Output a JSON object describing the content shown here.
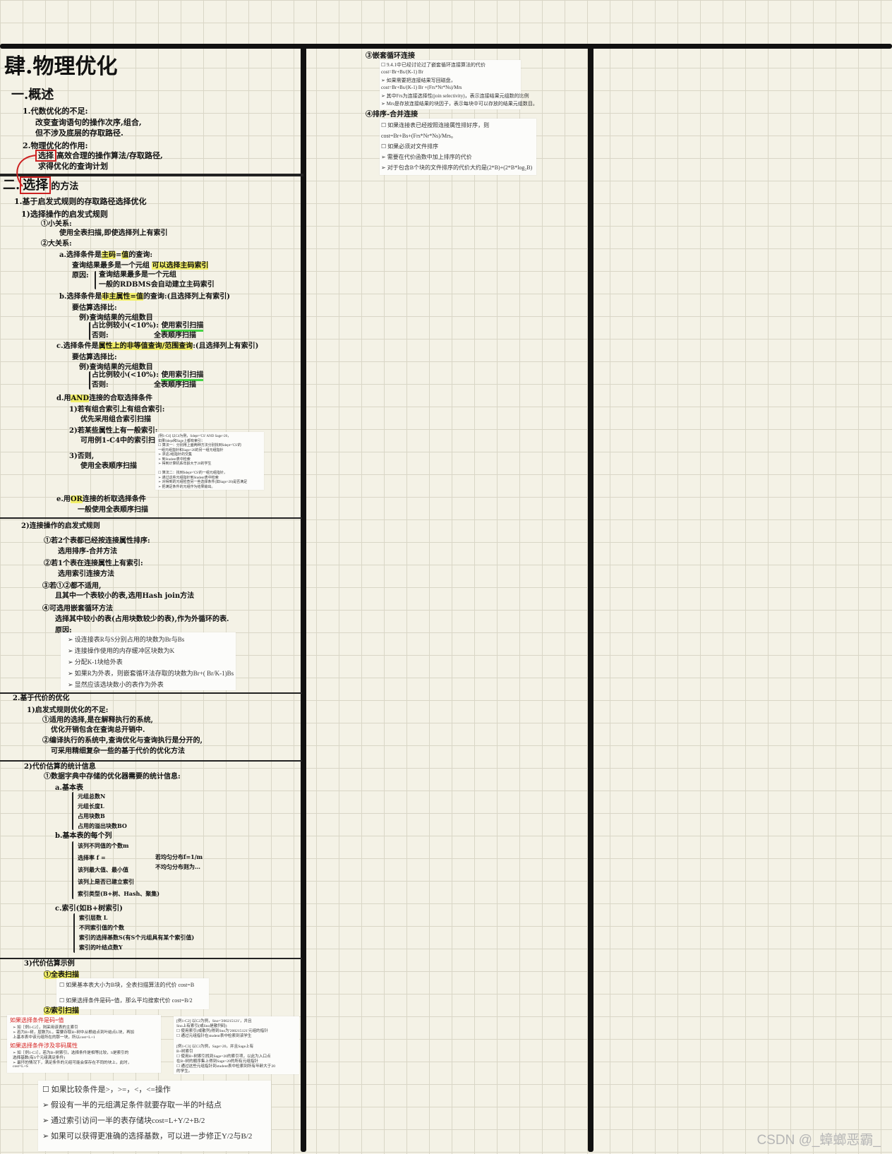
{
  "title": "肆.物理优化",
  "sec1": {
    "heading": "一.概述",
    "p1": "1.代数优化的不足:",
    "p1a": "改变查询语句的操作次序,组合,",
    "p1b": "但不涉及底层的存取路径.",
    "p2": "2.物理优化的作用:",
    "p2a_box": "选择",
    "p2a": "高效合理的操作算法/存取路径,",
    "p2b": "求得优化的查询计划"
  },
  "sec2": {
    "heading_prefix": "二.",
    "heading_box": "选择",
    "heading_suffix": "的方法",
    "s1": "1.基于启发式规则的存取路径选择优化",
    "s1a": "1)选择操作的启发式规则",
    "s1a1": "①小关系:",
    "s1a1a": "使用全表扫描,即使选择列上有索引",
    "s1a2": "②大关系:",
    "a": "a.选择条件是",
    "a_hl1": "主码",
    "a_mid": "=",
    "a_hl2": "值",
    "a_end": "的查询:",
    "a1": "查询结果最多是一个元组",
    "a1b": "可以选择主码索引",
    "a2": "原因:",
    "a2a": "查询结果最多是一个元组",
    "a2b": "一般的RDBMS会自动建立主码索引",
    "b": "b.选择条件是",
    "b_hl": "非主属性=值",
    "b_end": "的查询:(且选择列上有索引)",
    "b1": "要估算选择比:",
    "b1a": "例)查询结果的元组数目",
    "b1b": "占比例较小(<10%):",
    "b1c": "使用索引扫描",
    "b1d": "否则:",
    "b1e": "全表顺序扫描",
    "c": "c.选择条件是",
    "c_hl": "属性上的非等值查询/范围查询",
    "c_end": ":(且选择列上有索引)",
    "c1": "要估算选择比:",
    "c1a": "例)查询结果的元组数目",
    "c1b": "占比例较小(<10%):",
    "c1c": "使用索引扫描",
    "c1d": "否则:",
    "c1e": "全表顺序扫描",
    "d": "d.用",
    "d_hl": "AND",
    "d_end": "连接的合取选择条件",
    "d1": "1)若有组合索引上有组合索引:",
    "d1a": "优先采用组合索引扫描",
    "d2": "2)若某些属性上有一般索引:",
    "d2a": "可用例1-C4中的索引扫描",
    "d3": "3)否则,",
    "d3a": "使用全表顺序扫描",
    "e": "e.用",
    "e_hl": "OR",
    "e_end": "连接的析取选择条件",
    "e1": "一般使用全表顺序扫描",
    "s1b": "2)连接操作的启发式规则",
    "j1": "①若2个表都已经按连接属性排序:",
    "j1a": "选用排序-合并方法",
    "j2": "②若1个表在连接属性上有索引:",
    "j2a": "选用索引连接方法",
    "j3": "③若①②都不适用,",
    "j3a": "且其中一个表较小的表,选用Hash join方法",
    "j4": "④可选用嵌套循环方法",
    "j4a": "选择其中较小的表(占用块数较少的表),作为外循环的表.",
    "j4b": "原因:",
    "s2": "2.基于代价的优化",
    "s2a": "1)启发式规则优化的不足:",
    "s2a1": "①适用的选择,是在解释执行的系统,",
    "s2a1b": "优化开销包含在查询总开销中.",
    "s2a2": "②编译执行的系统中,查询优化与查询执行是分开的,",
    "s2a2b": "可采用精细复杂一些的基于代价的优化方法",
    "s3": "2)代价估算的统计信息",
    "s3a": "①数据字典中存储的优化器需要的统计信息:",
    "s3a1": "a.基本表",
    "s3a1i": [
      "元组总数N",
      "元组长度L",
      "占用块数B",
      "占用的溢出块数BO"
    ],
    "s3a2": "b.基本表的每个列",
    "s3a2i": [
      "该列不同值的个数m",
      "选择率 f =",
      "该列最大值、最小值",
      "该列上是否已建立索引",
      "索引类型(B+树、Hash、聚集)"
    ],
    "s3a2x1": "若均匀分布f=1/m",
    "s3a2x2": "不均匀分布则为…",
    "s3a3": "c.索引(如B+树索引)",
    "s3a3i": [
      "索引层数 L",
      "不同索引值的个数",
      "索引的选择基数S(有S个元组具有某个索引值)",
      "索引的叶结点数Y"
    ],
    "s4": "3)代价估算示例",
    "s4a": "①全表扫描",
    "s4b": "②索引扫描",
    "s4c_prefix": "c."
  },
  "right": {
    "h1": "③嵌套循环连接",
    "h2": "④排序-合并连接"
  },
  "cards": {
    "c4": [
      "[例1-C4] 以C4为例，Sdept='CS' AND Sage>20，",
      "如果Sdept和Sage上都有索引：",
      "☐ 算法一：分别用上面两种方法分别找到Sdept='CS'的",
      "  一组元组指针和Sage>20的另一组元组指针",
      "  ➢ 求这2组指针的交集",
      "  ➢ 到Student表中检索",
      "  ➢ 得到计算机系年龄大于20的学生",
      "",
      "☐ 算法二：找到Sdept='CS'的一组元组指针，",
      "  ➢ 通过这些元组指针到Student表中检索",
      "  ➢ 对得到的元组检查另一些选择条件(如Sage>20)是否满足",
      "  ➢ 把满足条件的元组作为结果输出。"
    ],
    "join": [
      "设连接表R与S分别占用的块数为Br与Bs",
      "连接操作使用的内存缓冲区块数为K",
      "分配K-1块给外表",
      "如果R为外表，则嵌套循环法存取的块数为Br+( Br/K-1)Bs",
      "显然应该选块数小的表作为外表"
    ],
    "scan": [
      "☐ 如果基本表大小为B块，全表扫描算法的代价 cost=B",
      "☐ 如果选择条件是码=值，那么平均搜索代价 cost=B/2"
    ],
    "idx_a_head": "如果选择条件是码=值",
    "idx_a": [
      "➢ 如［例1-C2］，则采用该表的主索引",
      "➢ 若为B+树，层数为L，需要存取B+树中从根结点到叶结点L块，再加",
      "  上基本表中该元组所在的那一块，所以cost=L+1"
    ],
    "idx_b_head": "如果选择条件涉及非码属性",
    "idx_b": [
      "➢ 如［例1-C3］，若为B+树索引，选择条件是相等比较，S是索引的",
      "  选择基数(有S个元组满足条件)",
      "➢ 最坏的情况下，满足条件的元组可能会保存在不同的块上，此时，",
      "  cost=L+S"
    ],
    "ex_c2": [
      "[例1-C2] 以C2为例，Sno='200215121'，并且",
      "Sno上有索引(或Sno是散列码)",
      "☐ 使用索引(或散列)得到Sno为'200215121'元组的指针",
      "☐ 通过元组指针在student表中检索到该学生"
    ],
    "ex_c3": [
      "[例1-C3] 以C3为例，Sage>20，并且Sage上有",
      "B+树索引",
      "☐ 使用B+树索引找到Sage=20的索引项，以此为入口点",
      "  在B+树的顺序集上得到Sage>20的所有元组指针",
      "☐ 通过这些元组指针到student表中检索到所有年龄大于20",
      "  的学生。"
    ],
    "cmp": [
      "☐ 如果比较条件是>，>=，<，<=操作",
      "➢ 假设有一半的元组满足条件就要存取一半的叶结点",
      "➢ 通过索引访问一半的表存储块cost=L+Y/2+B/2",
      "➢ 如果可以获得更准确的选择基数，可以进一步修正Y/2与B/2"
    ],
    "nested": [
      "☐ 9.4.1中已经讨论过了嵌套循环连接算法的代价",
      "   cost=Br+Bs/(K-1) Br",
      "   ➢ 如果需要把连接结果写回磁盘，",
      "     cost=Br+Bs/(K-1) Br +(Frs*Nr*Ns)/Mrs",
      "     ➢ 其中Frs为连接选择性(join selectivity)，表示连接结果元组数的比例",
      "     ➢ Mrs是存放连接结果的块因子，表示每块中可以存放的结果元组数目。"
    ],
    "sortmerge": [
      "☐ 如果连接表已经按照连接属性排好序，则",
      "   cost=Br+Bs+(Frs*Nr*Ns)/Mrs。",
      "☐ 如果必须对文件排序",
      "   ➢ 需要在代价函数中加上排序的代价",
      "   ➢ 对于包含B个块的文件排序的代价大约是(2*B)+(2*B*log₂B)"
    ]
  },
  "watermark": "CSDN @_蟑螂恶霸_",
  "colors": {
    "red": "#d62020",
    "yellow": "#f3f06a",
    "green": "#45d445",
    "grid": "#d9d6c6",
    "paper": "#f4f2e6"
  }
}
